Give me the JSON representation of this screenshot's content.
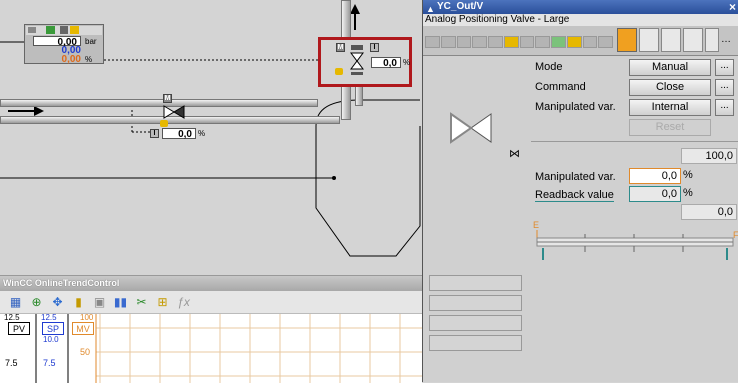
{
  "diagram": {
    "top_block": {
      "value1": "0,00",
      "unit1": "bar",
      "value2": "0,00",
      "value3": "0,00",
      "unit3": "%"
    },
    "selected_valve": {
      "badge_m": "M",
      "badge_i": "I",
      "value": "0,0",
      "unit": "%"
    },
    "lower_valve": {
      "badge_m": "M",
      "badge_i": "I",
      "value": "0,0",
      "unit": "%"
    }
  },
  "trend": {
    "title": "WinCC OnlineTrendControl",
    "tags": {
      "pv": "PV",
      "sp": "SP",
      "mv": "MV"
    },
    "axis1": {
      "top": "12.5",
      "mid": "7.5"
    },
    "axis2": {
      "top": "12.5",
      "sub": "10.0",
      "mid": "7.5"
    },
    "axis3": {
      "top": "100",
      "mid": "50"
    }
  },
  "faceplate": {
    "title": "YC_Out/V",
    "subtitle": "Analog Positioning Valve - Large",
    "close_glyph": "×",
    "rows": [
      {
        "label": "Mode",
        "value": "Manual"
      },
      {
        "label": "Command",
        "value": "Close"
      },
      {
        "label": "Manipulated var.",
        "value": "Internal"
      }
    ],
    "more_label": "...",
    "reset_label": "Reset",
    "range_high": "100,0",
    "range_low": "0,0",
    "manipulated": {
      "label": "Manipulated var.",
      "value": "0,0",
      "unit": "%"
    },
    "readback": {
      "label": "Readback value",
      "value": "0,0",
      "unit": "%"
    },
    "bar_labels": {
      "left": "E",
      "right": "F"
    },
    "valve_icon_small": "⋈",
    "colors": {
      "title_bar": "#2a4f9a",
      "selection_frame": "#b0181c",
      "orange_border": "#e08a2c",
      "teal_border": "#2d8b8b"
    }
  }
}
